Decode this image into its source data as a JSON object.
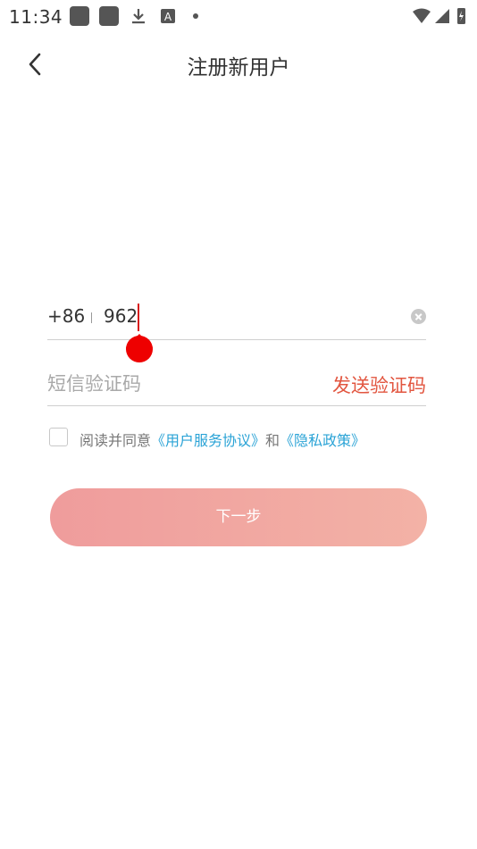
{
  "status_bar": {
    "time": "11:34",
    "icons": [
      "app-icon",
      "app-icon",
      "download-icon",
      "font-icon",
      "dot-icon"
    ],
    "right_icons": [
      "wifi-icon",
      "signal-icon",
      "battery-icon"
    ]
  },
  "header": {
    "title": "注册新用户",
    "back_icon": "chevron-left-icon"
  },
  "form": {
    "country_code": "+86",
    "phone_value": "962",
    "sms_placeholder": "短信验证码",
    "send_code_label": "发送验证码"
  },
  "agreement": {
    "prefix": "阅读并同意",
    "terms_link": "《用户服务协议》",
    "and": "和",
    "privacy_link": "《隐私政策》",
    "checked": false
  },
  "next_button": {
    "label": "下一步"
  },
  "colors": {
    "accent": "#e25640",
    "link": "#2aa3d6",
    "button_start": "#ef9c9c",
    "button_end": "#f3b2a6",
    "cursor": "#d81b1b"
  }
}
